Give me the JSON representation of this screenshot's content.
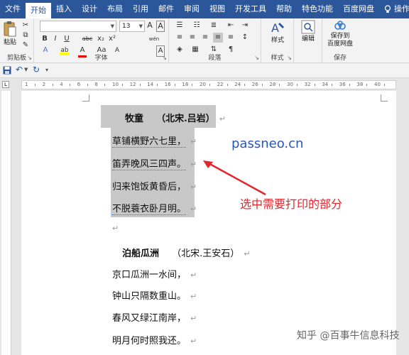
{
  "tabs": [
    "文件",
    "开始",
    "插入",
    "设计",
    "布局",
    "引用",
    "邮件",
    "审阅",
    "视图",
    "开发工具",
    "帮助",
    "特色功能",
    "百度网盘"
  ],
  "active_tab": "开始",
  "help_search": "操作说明搜索",
  "ribbon": {
    "clipboard": {
      "paste": "粘贴",
      "label": "剪贴板"
    },
    "font": {
      "font_name": "",
      "font_size": "13",
      "label": "字体",
      "bold": "B",
      "italic": "I",
      "underline": "U",
      "strike": "abc",
      "sub": "x₂",
      "sup": "x²",
      "effects": "A",
      "highlight": "ab",
      "color": "A",
      "case": "Aa",
      "grow": "A",
      "shrink": "A",
      "clear": "A",
      "phonetic": "wén",
      "border": "A"
    },
    "paragraph": {
      "label": "段落"
    },
    "styles": {
      "btn": "样式",
      "label": "样式"
    },
    "editing": {
      "btn": "编辑",
      "label": ""
    },
    "save": {
      "btn1": "保存到",
      "btn2": "百度网盘",
      "label": "保存"
    }
  },
  "ruler": [
    "1",
    "2",
    "4",
    "6",
    "8",
    "10",
    "12",
    "14",
    "16",
    "18",
    "20",
    "22",
    "24",
    "26",
    "28",
    "30",
    "32",
    "34",
    "36",
    "38",
    "40"
  ],
  "poem1": {
    "title": "牧童",
    "author": "（北宋.吕岩）",
    "lines": [
      "草铺横野六七里，",
      "笛弄晚风三四声。",
      "归来饱饭黄昏后，",
      "不脱蓑衣卧月明。"
    ]
  },
  "poem2": {
    "title": "泊船瓜洲",
    "author": "（北宋.王安石）",
    "lines": [
      "京口瓜洲一水间，",
      "钟山只隔数重山。",
      "春风又绿江南岸，",
      "明月何时照我还。"
    ]
  },
  "paragraph_mark": "↵",
  "watermark": "passneo.cn",
  "annotation": "选中需要打印的部分",
  "credit": "知乎 @百事牛信息科技",
  "colors": {
    "title_bar": "#2b579a",
    "annotation": "#e2262c",
    "watermark": "#2857b4",
    "selection": "#c8c8c8"
  }
}
